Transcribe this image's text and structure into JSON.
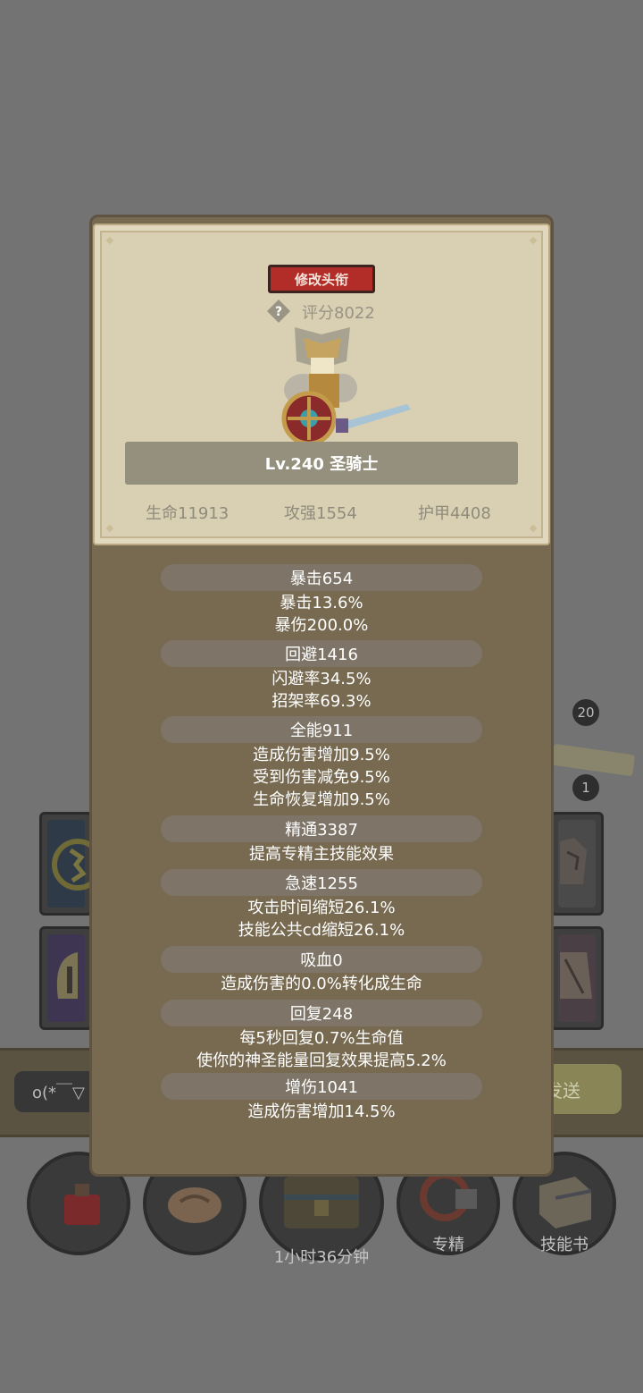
{
  "background": {
    "badges": [
      "20",
      "1"
    ],
    "chat_input_text": "o(*￣▽",
    "send_button_label": "发送",
    "dock": [
      {
        "label": ""
      },
      {
        "label": ""
      },
      {
        "label": "1小时36分钟"
      },
      {
        "label": "专精"
      },
      {
        "label": "技能书"
      }
    ]
  },
  "profile": {
    "rename_button": "修改头衔",
    "help_glyph": "?",
    "score": "评分8022",
    "name": "Lv.240 圣骑士",
    "stats": {
      "hp": "生命11913",
      "attack": "攻强1554",
      "armor": "护甲4408"
    }
  },
  "attributes": [
    {
      "title": "暴击654",
      "lines": [
        "暴击13.6%",
        "暴伤200.0%"
      ]
    },
    {
      "title": "回避1416",
      "lines": [
        "闪避率34.5%",
        "招架率69.3%"
      ]
    },
    {
      "title": "全能911",
      "lines": [
        "造成伤害增加9.5%",
        "受到伤害减免9.5%",
        "生命恢复增加9.5%"
      ]
    },
    {
      "title": "精通3387",
      "lines": [
        "提高专精主技能效果"
      ]
    },
    {
      "title": "急速1255",
      "lines": [
        "攻击时间缩短26.1%",
        "技能公共cd缩短26.1%"
      ]
    },
    {
      "title": "吸血0",
      "lines": [
        "造成伤害的0.0%转化成生命"
      ]
    },
    {
      "title": "回复248",
      "lines": [
        "每5秒回复0.7%生命值",
        "使你的神圣能量回复效果提高5.2%"
      ]
    },
    {
      "title": "增伤1041",
      "lines": [
        "造成伤害增加14.5%"
      ]
    }
  ],
  "colors": {
    "overlay": "#737373",
    "panel": "#776a51",
    "card": "#d9cfb2",
    "rename_button": "#b32d28",
    "attr_header": "#7e7568"
  }
}
